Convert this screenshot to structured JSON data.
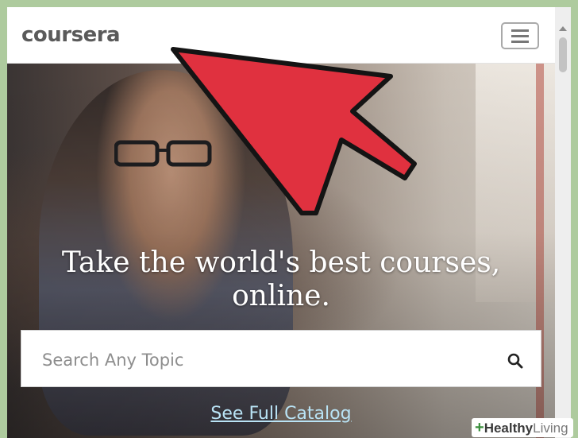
{
  "header": {
    "logo_text": "coursera",
    "menu_icon": "hamburger-menu-icon"
  },
  "hero": {
    "headline_line1": "Take the world's best courses,",
    "headline_line2": "online."
  },
  "search": {
    "placeholder": "Search Any Topic",
    "value": "",
    "icon": "search-icon"
  },
  "catalog_link": "See Full Catalog",
  "annotation": {
    "type": "red-arrow",
    "color": "#e0313f",
    "points_to": "coursera logo"
  },
  "watermark": {
    "part1": "Healthy",
    "part2": "Living"
  },
  "colors": {
    "frame_background": "#aecb9e",
    "link": "#b9e3f5",
    "logo": "#5a5a5a"
  }
}
